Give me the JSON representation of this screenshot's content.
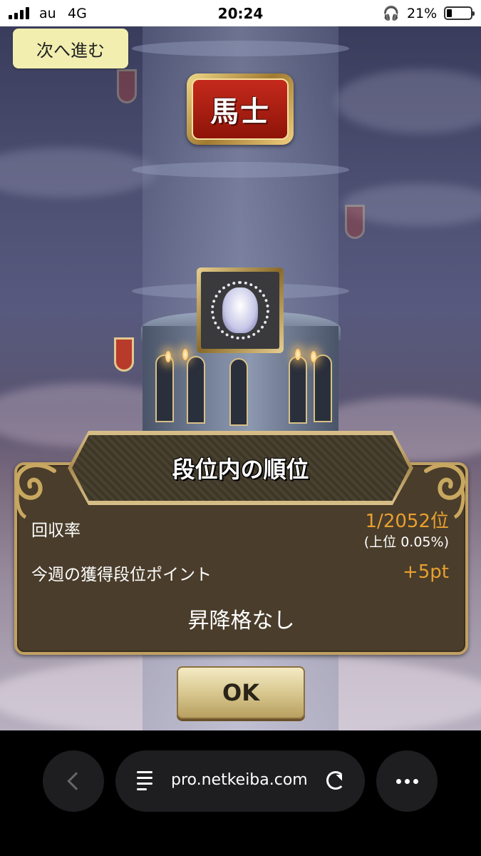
{
  "status_bar": {
    "carrier": "au",
    "network": "4G",
    "time": "20:24",
    "battery_percent": "21%"
  },
  "game": {
    "next_button_label": "次へ進む",
    "rank_title": "馬士",
    "dialog": {
      "title": "段位内の順位",
      "rows": [
        {
          "label": "回収率",
          "value": "1/2052位",
          "sub": "(上位 0.05%)"
        },
        {
          "label": "今週の獲得段位ポイント",
          "value": "+5pt"
        }
      ],
      "result": "昇降格なし"
    },
    "ok_button_label": "OK"
  },
  "browser": {
    "url": "pro.netkeiba.com",
    "icons": [
      "back-icon",
      "reader-icon",
      "reload-icon",
      "more-icon"
    ]
  },
  "colors": {
    "accent_value": "#e8a030",
    "dialog_bg": "#4a3d2b",
    "next_button_bg": "#f1eeaf",
    "rank_red": "#c42a1c"
  }
}
